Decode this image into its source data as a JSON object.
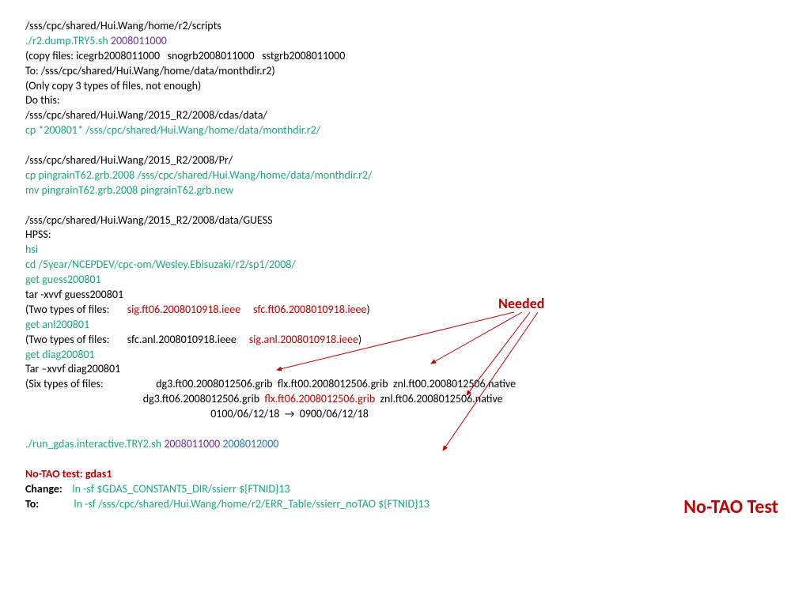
{
  "l1": "/sss/cpc/shared/Hui.Wang/home/r2/scripts",
  "l2a": "./r2.dump.TRY5.sh ",
  "l2b": "2008011000",
  "l3": "(copy files: icegrb2008011000   snogrb2008011000   sstgrb2008011000",
  "l4": "To: /sss/cpc/shared/Hui.Wang/home/data/monthdir.r2)",
  "l5": "(Only copy 3 types of files, not enough)",
  "l6": "Do this:",
  "l7": "/sss/cpc/shared/Hui.Wang/2015_R2/2008/cdas/data/",
  "l8": "cp *200801* /sss/cpc/shared/Hui.Wang/home/data/monthdir.r2/",
  "l9": "/sss/cpc/shared/Hui.Wang/2015_R2/2008/Pr/",
  "l10": "cp pingrainT62.grb.2008 /sss/cpc/shared/Hui.Wang/home/data/monthdir.r2/",
  "l11": "mv pingrainT62.grb.2008 pingrainT62.grb.new",
  "l12": "/sss/cpc/shared/Hui.Wang/2015_R2/2008/data/GUESS",
  "l13": "HPSS:",
  "l14": "hsi",
  "l15": "cd /5year/NCEPDEV/cpc-om/Wesley.Ebisuzaki/r2/sp1/2008/",
  "l16": "get guess200801",
  "l17": "tar -xvvf guess200801",
  "l18a": "(Two types of files:       ",
  "l18b": "sig.ft06.2008010918.ieee     sfc.ft06.2008010918.ieee",
  "l18c": ")",
  "l19": "get anl200801",
  "l20a": "(Two types of files:       sfc.anl.2008010918.ieee     ",
  "l20b": "sig.anl.2008010918.ieee",
  "l20c": ")",
  "l21": "get diag200801",
  "l22": "Tar –xvvf diag200801",
  "l23a": "(Six types of files:                     dg3.ft00.2008012506.grib  flx.ft00.2008012506.grib  znl.ft00.2008012506.native",
  "l24a": "                                               dg3.ft06.2008012506.grib  ",
  "l24b": "flx.ft06.2008012506.grib",
  "l24c": "  znl.ft06.2008012506.native",
  "l25": "                                                                          0100/06/12/18  →  0900/06/12/18",
  "l26a": "./run_gdas.interactive.TRY2.sh ",
  "l26b": "2008011000 ",
  "l26c": "2008012000",
  "l27": "No-TAO test: gdas1",
  "l28a": "Change:",
  "l28b": "    ln -sf $GDAS_CONSTANTS_DIR/ssierr ${FTNID}13",
  "l29a": "To:",
  "l29b": "              ln -sf /sss/cpc/shared/Hui.Wang/home/r2/ERR_Table/ssierr_noTAO ${FTNID}13",
  "needed": "Needed",
  "notao": "No-TAO Test"
}
